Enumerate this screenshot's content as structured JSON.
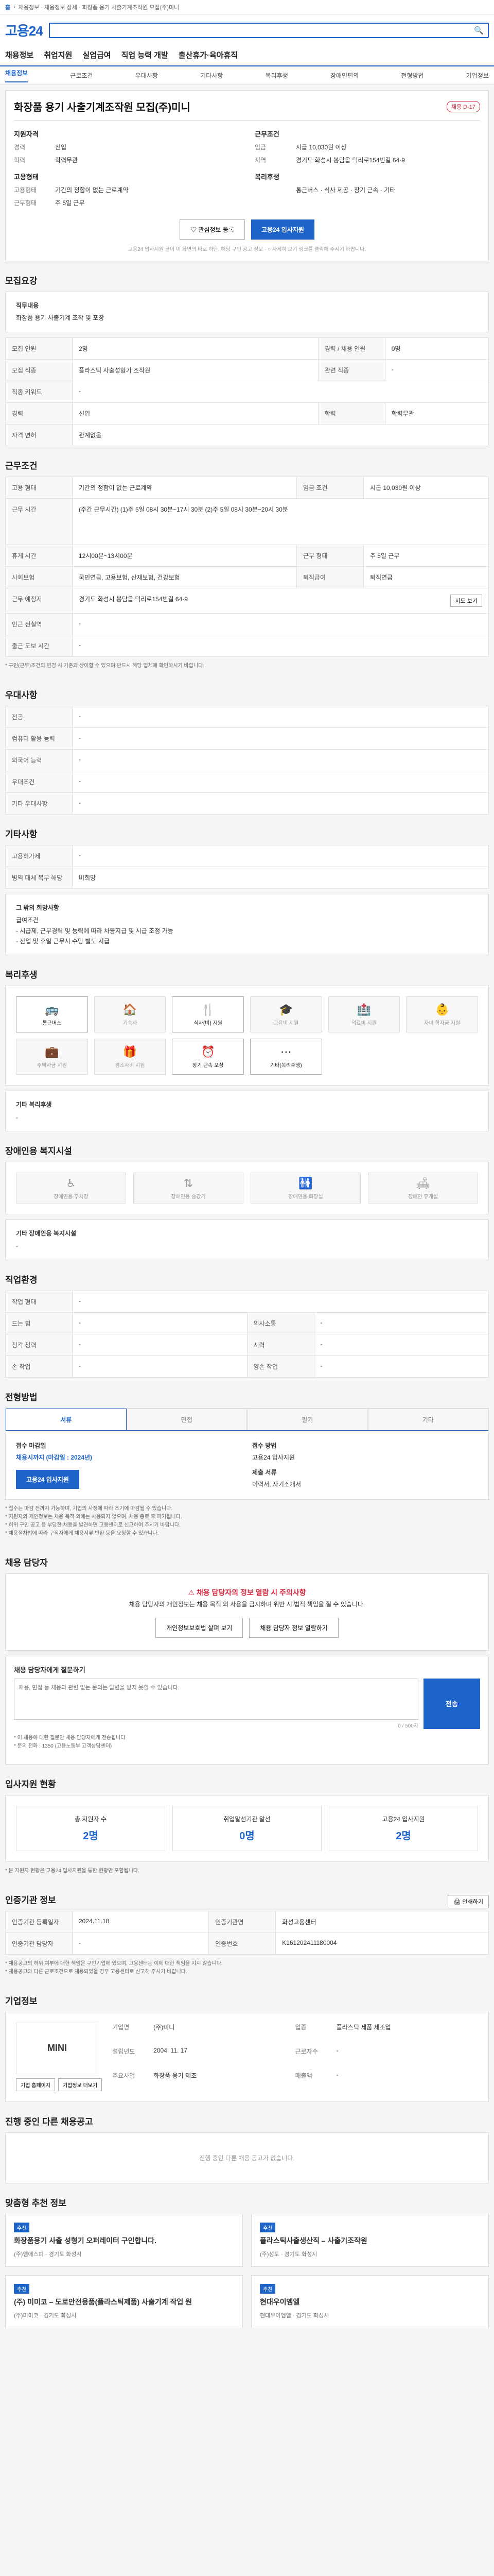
{
  "topbar": {
    "home": "홈",
    "crumb": "채용정보 · 채용정보 상세 · 화장품 용기 사출기계조작원 모집(주)미니"
  },
  "header": {
    "logo": "고용24",
    "nav": [
      "채용정보",
      "취업지원",
      "실업급여",
      "직업 능력 개발",
      "출산휴가·육아휴직"
    ],
    "subnav": [
      "채용정보",
      "근로조건",
      "우대사항",
      "기타사항",
      "복리후생",
      "장애인편의",
      "전형방법",
      "기업정보"
    ]
  },
  "job": {
    "title": "화장품 용기 사출기계조작원 모집(주)미니",
    "tag": "채용 D-17",
    "company_label": "지원자격",
    "left": {
      "head": "지원자격",
      "rows": [
        {
          "k": "경력",
          "v": "신입"
        },
        {
          "k": "학력",
          "v": "학력무관"
        }
      ],
      "head2": "고용형태",
      "rows2": [
        {
          "k": "고용형태",
          "v": "기간의 정함이 없는 근로계약"
        },
        {
          "k": "근무형태",
          "v": "주 5일 근무"
        }
      ]
    },
    "right": {
      "head": "근무조건",
      "rows": [
        {
          "k": "임금",
          "v": "시급 10,030원 이상"
        },
        {
          "k": "지역",
          "v": "경기도 화성시 봉담읍 덕리로154번길 64-9"
        }
      ],
      "head2": "복리후생",
      "rows2": [
        {
          "k": "",
          "v": "통근버스 · 식사 제공 · 장기 근속 · 기타"
        }
      ]
    },
    "btn_save": "관심정보 등록",
    "btn_apply": "고용24 입사지원",
    "note": "고용24 입사지원 글이 이 화면의 바로 하단, 해당 구인 공고 정보 · ○ 자세히 보기 링크를 클릭해 주시기 바랍니다."
  },
  "recruit": {
    "title": "모집요강",
    "desc_head": "직무내용",
    "desc": "화장품 용기 사출기계 조작 및 포장",
    "rows": [
      {
        "k": "모집 인원",
        "v": "2명",
        "k2": "경력 / 채용 인원",
        "v2": "0명"
      },
      {
        "k": "모집 직종",
        "v": "플라스틱 사출성형기 조작원",
        "k2": "관련 직종",
        "v2": "-"
      },
      {
        "k": "직종 키워드",
        "v": "-",
        "k2": "",
        "v2": ""
      },
      {
        "k": "경력",
        "v": "신입",
        "k2": "학력",
        "v2": "학력무관"
      },
      {
        "k": "자격 면허",
        "v": "관계없음",
        "k2": "",
        "v2": ""
      }
    ]
  },
  "conditions": {
    "title": "근무조건",
    "rows": [
      {
        "k": "고용 형태",
        "v": "기간의 정함이 없는 근로계약",
        "k2": "임금 조건",
        "v2": "시급 10,030원 이상"
      },
      {
        "k": "근무 시간",
        "v": "(주간 근무시간) (1)주 5일 08시 30분~17시 30분 (2)주 5일 08시 30분~20시 30분",
        "k2": "",
        "v2": ""
      },
      {
        "k": "휴게 시간",
        "v": "12시00분~13시00분",
        "k2": "근무 형태",
        "v2": "주 5일 근무"
      },
      {
        "k": "사회보험",
        "v": "국민연금, 고용보험, 산재보험, 건강보험",
        "k2": "퇴직급여",
        "v2": "퇴직연금"
      },
      {
        "k": "근무 예정지",
        "v": "경기도 화성시 봉담읍 덕리로154번길 64-9",
        "k2": "",
        "v2": ""
      },
      {
        "k": "인근 전철역",
        "v": "-",
        "k2": "",
        "v2": ""
      },
      {
        "k": "출근 도보 시간",
        "v": "-",
        "k2": "",
        "v2": ""
      }
    ],
    "map_btn": "지도 보기",
    "note": "* 구인(근무)조건의 변경 시 기존과 상이할 수 있으며 반드시 해당 업체에 확인하시기 바랍니다."
  },
  "preference": {
    "title": "우대사항",
    "rows": [
      {
        "k": "전공",
        "v": "-"
      },
      {
        "k": "컴퓨터 활용 능력",
        "v": "-"
      },
      {
        "k": "외국어 능력",
        "v": "-"
      },
      {
        "k": "우대조건",
        "v": "-"
      },
      {
        "k": "기타 우대사항",
        "v": "-"
      }
    ]
  },
  "etc": {
    "title": "기타사항",
    "rows": [
      {
        "k": "고용허가제",
        "v": "-"
      },
      {
        "k": "병역 대체 복무 해당",
        "v": "비희망"
      }
    ],
    "extra_head": "그 밖의 희망사항",
    "extra": "급여조건\n- 시급제, 근무경력 및 능력에 따라 차등지급 및 시급 조정 가능\n- 잔업 및 휴일 근무시 수당 별도 지급"
  },
  "benefits": {
    "title": "복리후생",
    "items": [
      {
        "icon": "🚌",
        "label": "통근버스",
        "on": true
      },
      {
        "icon": "🏠",
        "label": "기숙사",
        "on": false
      },
      {
        "icon": "🍴",
        "label": "식사(비) 지원",
        "on": true
      },
      {
        "icon": "🎓",
        "label": "교육비 지원",
        "on": false
      },
      {
        "icon": "🏥",
        "label": "의료비 지원",
        "on": false
      },
      {
        "icon": "👶",
        "label": "자녀 학자금 지원",
        "on": false
      },
      {
        "icon": "💼",
        "label": "주택자금 지원",
        "on": false
      },
      {
        "icon": "🎁",
        "label": "경조사비 지원",
        "on": false
      },
      {
        "icon": "⏰",
        "label": "장기 근속 포상",
        "on": true
      },
      {
        "icon": "⋯",
        "label": "기타(복리후생)",
        "on": true
      }
    ],
    "extra_head": "기타 복리후생",
    "extra": "-"
  },
  "disability": {
    "title": "장애인용 복지시설",
    "items": [
      "장애인용 주차장",
      "장애인용 승강기",
      "장애인용 화장실",
      "장애인 휴게실"
    ],
    "extra_head": "기타 장애인용 복지시설",
    "extra": "-"
  },
  "duty": {
    "title": "직업환경",
    "rows": [
      {
        "k": "작업 형태",
        "v": "-",
        "k2": "",
        "v2": ""
      },
      {
        "k": "드는 힘",
        "v": "-",
        "k2": "의사소통",
        "v2": "-"
      },
      {
        "k": "청각 청력",
        "v": "-",
        "k2": "시력",
        "v2": "-"
      },
      {
        "k": "손 작업",
        "v": "-",
        "k2": "양손 작업",
        "v2": "-"
      }
    ]
  },
  "selection": {
    "title": "전형방법",
    "tabs": [
      "서류",
      "면접",
      "필기",
      "기타"
    ],
    "method_head": "접수 마감일",
    "method": "채용시까지 (마감일 : 2024년)",
    "apply_head": "접수 방법",
    "apply": "고용24 입사지원",
    "doc_head": "제출 서류",
    "doc": "이력서, 자기소개서",
    "apply_btn": "고용24 입사지원",
    "notes": [
      "* 접수는 마감 전까지 가능하며, 기업의 사정에 따라 조기에 마감될 수 있습니다.",
      "* 지원자의 개인정보는 채용 목적 외에는 사용되지 않으며, 채용 종료 후 파기됩니다.",
      "* 허위 구인 공고 등 부당한 채용을 발견하면 고용센터로 신고하여 주시기 바랍니다.",
      "* 채용절차법에 따라 구직자에게 채용서류 반환 등을 요청할 수 있습니다."
    ]
  },
  "contact": {
    "title": "채용 담당자",
    "alert_title": "채용 담당자의 정보 열람 시 주의사항",
    "alert_body": "채용 담당자의 개인정보는 채용 목적 외 사용을 금지하며 위반 시 법적 책임을 질 수 있습니다.",
    "btn1": "개인정보보호법 살펴 보기",
    "btn2": "채용 담당자 정보 열람하기"
  },
  "qna": {
    "head": "채용 담당자에게 질문하기",
    "placeholder": "채용, 면접 등 채용과 관련 없는 문의는 답변을 받지 못할 수 있습니다.",
    "count": "0 / 500자",
    "btn": "전송",
    "notes": [
      "* 이 채용에 대한 질문만 채용 담당자에게 전송됩니다.",
      "* 문의 전화 : 1350 (고용노동부 고객상담센터)"
    ]
  },
  "applicants": {
    "title": "입사지원 현황",
    "items": [
      {
        "label": "총 지원자 수",
        "value": "2명"
      },
      {
        "label": "취업알선기관 알선",
        "value": "0명"
      },
      {
        "label": "고용24 입사지원",
        "value": "2명"
      }
    ],
    "note": "* 본 지원자 현황은 고용24 입사지원을 통한 현황만 포함됩니다."
  },
  "info": {
    "title": "인증기관 정보",
    "print": "인쇄하기",
    "rows": [
      {
        "k": "인증기관 등록일자",
        "v": "2024.11.18",
        "k2": "인증기관명",
        "v2": "화성고용센터"
      },
      {
        "k": "인증기관 담당자",
        "v": "-",
        "k2": "인증번호",
        "v2": "K161202411180004"
      }
    ],
    "notes": [
      "* 채용공고의 허위 여부에 대한 책임은 구인기업에 있으며, 고용센터는 이에 대한 책임을 지지 않습니다.",
      "* 채용공고와 다른 근로조건으로 채용되었을 경우 고용센터로 신고해 주시기 바랍니다."
    ]
  },
  "company": {
    "title": "기업정보",
    "logo": "MINI",
    "btn1": "기업 홈페이지",
    "btn2": "기업정보 더보기",
    "rows": [
      {
        "k": "기업명",
        "v": "(주)미니",
        "k2": "업종",
        "v2": "플라스틱 제품 제조업"
      },
      {
        "k": "설립년도",
        "v": "2004. 11. 17",
        "k2": "근로자수",
        "v2": "-"
      },
      {
        "k": "주요사업",
        "v": "화장품 용기 제조",
        "k2": "매출액",
        "v2": "-"
      }
    ]
  },
  "others": {
    "title": "진행 중인 다른 채용공고",
    "empty": "진행 중인 다른 채용 공고가 없습니다."
  },
  "recommend": {
    "title": "맞춤형 추천 정보",
    "items": [
      {
        "badge": "추천",
        "title": "화장품용기 사출 성형기 오퍼레이터 구인합니다.",
        "meta": "(주)엠에스피 · 경기도 화성시"
      },
      {
        "badge": "추천",
        "title": "플라스틱사출생산직 – 사출기조작원",
        "meta": "(주)성도 · 경기도 화성시"
      },
      {
        "badge": "추천",
        "title": "(주) 미미코 – 도로안전용품(플라스틱제품) 사출기계 작업 원",
        "meta": "(주)미미코 · 경기도 화성시"
      },
      {
        "badge": "추천",
        "title": "현대우이엠엘",
        "meta": "현대우이엠엘 · 경기도 화성시"
      }
    ]
  }
}
